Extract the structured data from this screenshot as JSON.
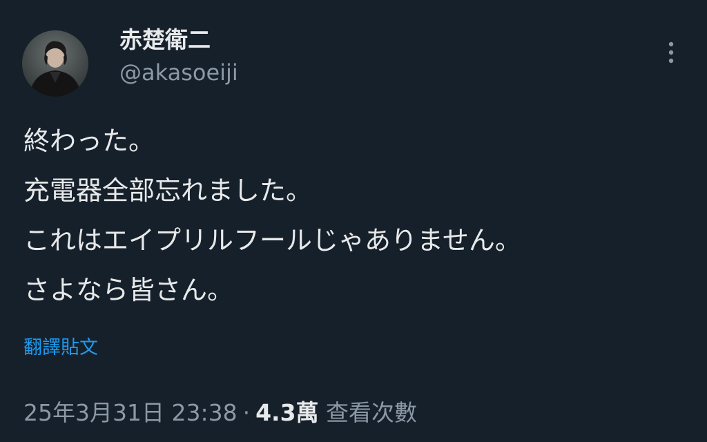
{
  "author": {
    "name": "赤楚衛二",
    "handle": "@akasoeiji",
    "avatar_icon": "profile-photo"
  },
  "more_icon": "more-vertical-icon",
  "tweet": {
    "lines": [
      "終わった。",
      "充電器全部忘れました。",
      "これはエイプリルフールじゃありません。",
      "さよなら皆さん。"
    ]
  },
  "translate_label": "翻譯貼文",
  "meta": {
    "timestamp": "25年3月31日 23:38",
    "separator": "·",
    "views_count": "4.3萬",
    "views_label": "查看次數"
  },
  "colors": {
    "background": "#16202b",
    "text": "#e7e9ea",
    "secondary": "#8b98a5",
    "link": "#1d9bf0"
  }
}
